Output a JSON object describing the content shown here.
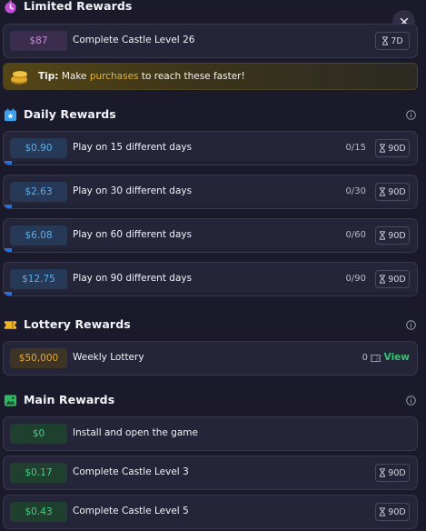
{
  "close_label": "×",
  "limited": {
    "title": "Limited Rewards",
    "rows": [
      {
        "reward": "$87",
        "task": "Complete Castle Level 26",
        "duration": "7D"
      }
    ]
  },
  "tip": {
    "lead": "Tip:",
    "text_before": "Make",
    "highlight": "purchases",
    "text_after": "to reach these faster!"
  },
  "daily": {
    "title": "Daily Rewards",
    "rows": [
      {
        "reward": "$0.90",
        "task": "Play on 15 different days",
        "progress": "0/15",
        "duration": "90D",
        "fill": 0.02
      },
      {
        "reward": "$2.63",
        "task": "Play on 30 different days",
        "progress": "0/30",
        "duration": "90D",
        "fill": 0.02
      },
      {
        "reward": "$6.08",
        "task": "Play on 60 different days",
        "progress": "0/60",
        "duration": "90D",
        "fill": 0.02
      },
      {
        "reward": "$12.75",
        "task": "Play on 90 different days",
        "progress": "0/90",
        "duration": "90D",
        "fill": 0.02
      }
    ]
  },
  "lottery": {
    "title": "Lottery Rewards",
    "rows": [
      {
        "reward": "$50,000",
        "task": "Weekly Lottery",
        "tickets": "0",
        "action": "View"
      }
    ]
  },
  "main": {
    "title": "Main Rewards",
    "rows": [
      {
        "reward": "$0",
        "task": "Install and open the game"
      },
      {
        "reward": "$0.17",
        "task": "Complete Castle Level 3",
        "duration": "90D"
      },
      {
        "reward": "$0.43",
        "task": "Complete Castle Level 5",
        "duration": "90D"
      }
    ]
  },
  "colors": {
    "background": "#1b1a2b",
    "card": "#25253a",
    "limited_badge": "#c98ad8",
    "daily_badge": "#59aef0",
    "lottery_badge": "#e2a83d",
    "main_badge": "#3ed17c",
    "view_link": "#37c46e",
    "progress_fill": "#2d6fd6"
  },
  "icons": {
    "limited": "stopwatch-icon",
    "daily": "calendar-star-icon",
    "lottery": "ticket-icon",
    "main": "image-icon",
    "info": "info-icon",
    "duration": "hourglass-icon",
    "tip": "coins-icon"
  }
}
